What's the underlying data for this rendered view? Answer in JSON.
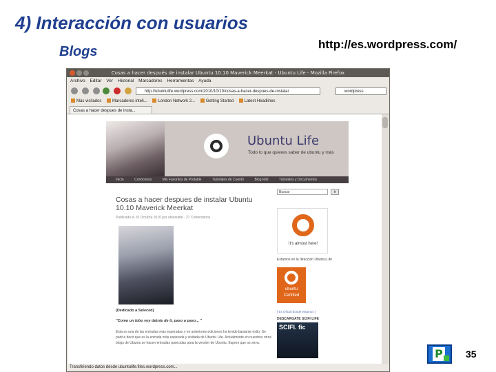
{
  "slide": {
    "title": "4) Interacción con usuarios",
    "subtitle": "Blogs",
    "url": "http://es.wordpress.com/",
    "page_number": "35"
  },
  "browser": {
    "window_title": "Cosas a hacer después de instalar Ubuntu 10.10 Maverick Meerkat - Ubuntu Life - Mozilla Firefox",
    "menu": [
      "Archivo",
      "Editar",
      "Ver",
      "Historial",
      "Marcadores",
      "Herramientas",
      "Ayuda"
    ],
    "address": "http://ubuntulife.wordpress.com/2010/10/10/cosas-a-hacer-despues-de-instalar",
    "search_value": "wordpress",
    "bookmarks": [
      "Más visitados",
      "Marcadores inteli...",
      "London Network 2...",
      "Getting Started",
      "Latest Headlines"
    ],
    "tab_label": "Cosas a hacer despues de insta...",
    "status": "Transfiriendo datos desde ubuntulife.files.wordpress.com..."
  },
  "blog": {
    "site_title": "Ubuntu Life",
    "tagline": "Todo lo que quieres saber de ubuntu y más",
    "nav": [
      "Inicio",
      "Conócenos",
      "Mis Favoritos de Portable",
      "Tutoriales de Cuento",
      "Blog Roll",
      "Tutoriales y Documentos"
    ],
    "post_title": "Cosas a hacer despues de instalar Ubuntu 10.10 Maverick Meerkat",
    "post_meta": "Publicado el 10 Octubre 2010 por ubuntulife  ·  27 Comentarios",
    "dedication": "(Dedicado a Seleced)",
    "quote": "\"Como un lobo voy detrás de ti, paso a paso... \"",
    "paragraph": "Esta es una de las entradas más esperadas y en anteriores ediciones ha tenido bastante éxito. Se podría decir que es la entrada más esperada y visitada de Ubuntu Life. Actualmente en nuestros otros blogs de Ubuntu se hacen entradas parecidas para la versión de Ubuntu. Espero que os sirva.",
    "sidebar": {
      "search_value": "Buscar",
      "search_button": "ir",
      "badge_version": "10.10",
      "badge_text": "It's almost here!",
      "caption1": "Estamos en la dirección Ubuntu Life",
      "certified": "ubuntu Certified",
      "caption2": "[ Es Oficial donde estamos ]",
      "caption3": "DESCARGATE SCIFI LIFE",
      "scifi": "SCIFI. fic"
    }
  }
}
